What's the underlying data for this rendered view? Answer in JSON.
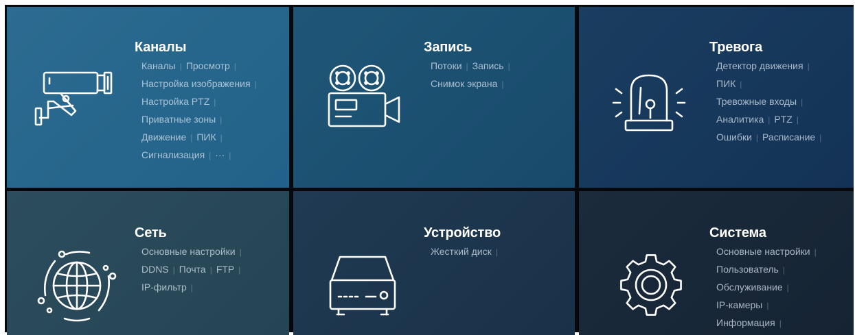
{
  "tiles": {
    "channels": {
      "title": "Каналы",
      "icon": "cctv-camera-icon",
      "lines": [
        [
          "Каналы",
          "Просмотр"
        ],
        [
          "Настройка изображения"
        ],
        [
          "Настройка PTZ"
        ],
        [
          "Приватные зоны"
        ],
        [
          "Движение",
          "ПИК"
        ],
        [
          "Сигнализация",
          "···"
        ]
      ]
    },
    "record": {
      "title": "Запись",
      "icon": "film-camera-icon",
      "lines": [
        [
          "Потоки",
          "Запись"
        ],
        [
          "Снимок экрана"
        ]
      ]
    },
    "alarm": {
      "title": "Тревога",
      "icon": "alarm-siren-icon",
      "lines": [
        [
          "Детектор движения"
        ],
        [
          "ПИК"
        ],
        [
          "Тревожные входы"
        ],
        [
          "Аналитика",
          "PTZ"
        ],
        [
          "Ошибки",
          "Расписание"
        ]
      ]
    },
    "network": {
      "title": "Сеть",
      "icon": "globe-network-icon",
      "lines": [
        [
          "Основные настройки"
        ],
        [
          "DDNS",
          "Почта",
          "FTP"
        ],
        [
          "IP-фильтр"
        ]
      ]
    },
    "device": {
      "title": "Устройство",
      "icon": "hard-disk-recorder-icon",
      "lines": [
        [
          "Жесткий диск"
        ]
      ]
    },
    "system": {
      "title": "Система",
      "icon": "gear-icon",
      "lines": [
        [
          "Основные настройки"
        ],
        [
          "Пользователь"
        ],
        [
          "Обслуживание"
        ],
        [
          "IP-камеры"
        ],
        [
          "Информация"
        ]
      ]
    }
  }
}
